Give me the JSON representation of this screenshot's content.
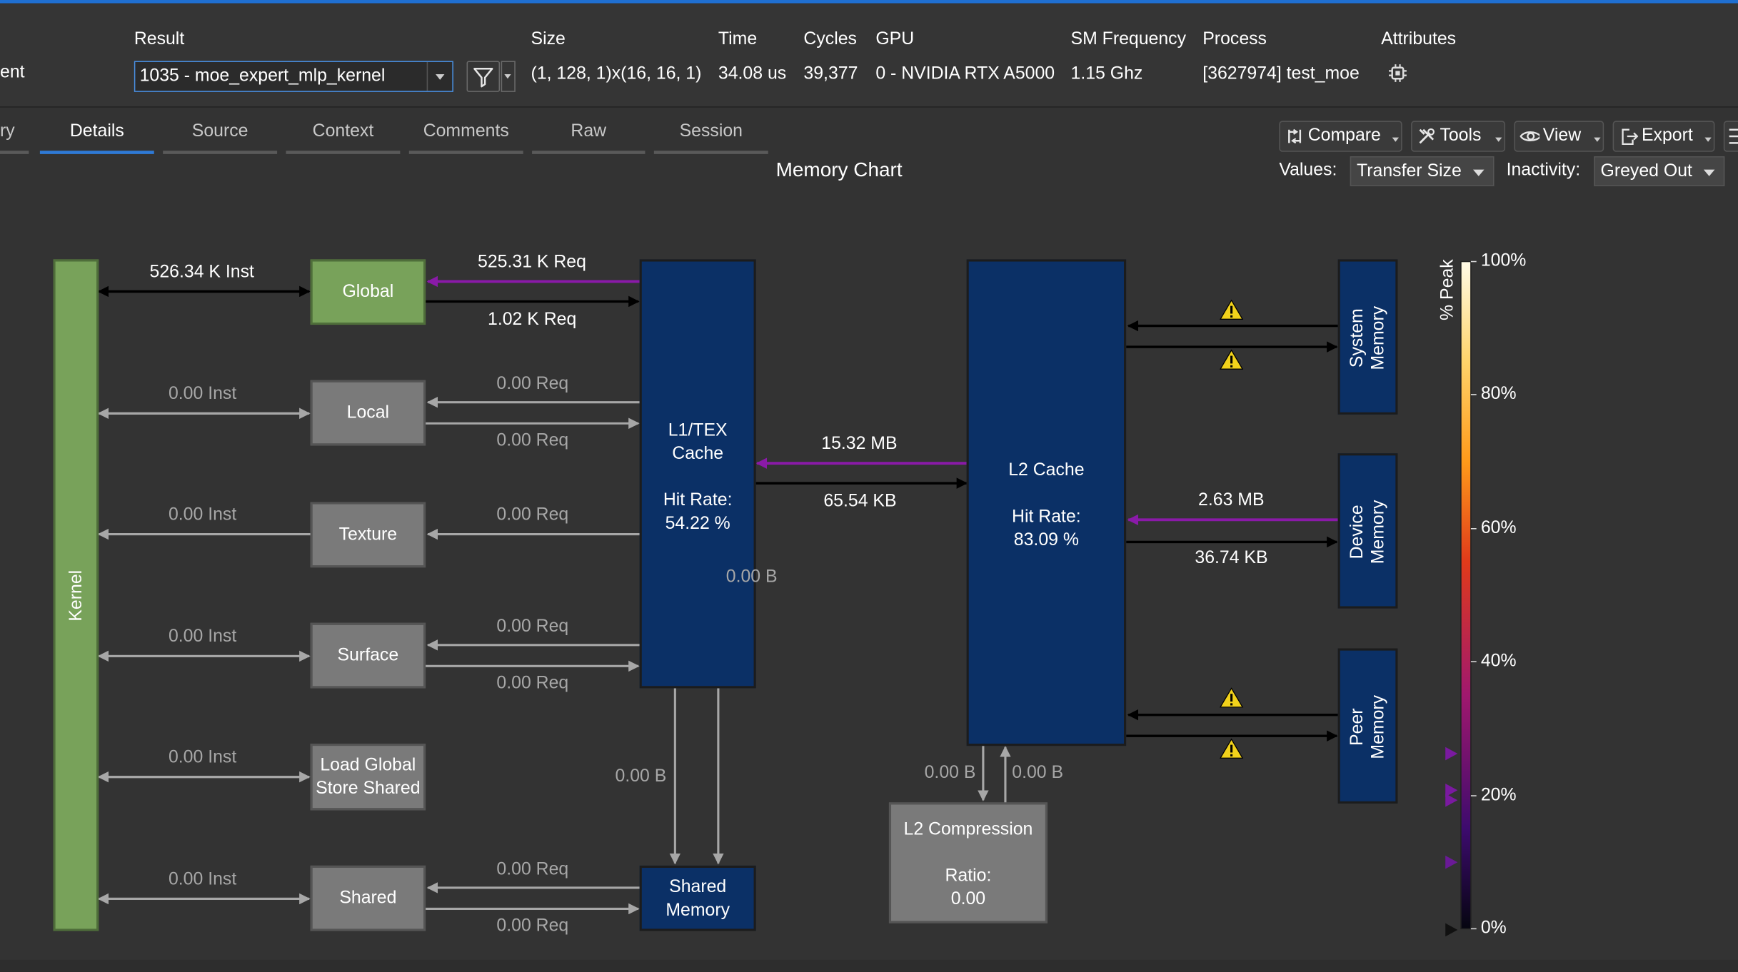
{
  "header": {
    "left_cut_label": "ent",
    "columns": {
      "result": "Result",
      "size": "Size",
      "time": "Time",
      "cycles": "Cycles",
      "gpu": "GPU",
      "sm_frequency": "SM Frequency",
      "process": "Process",
      "attributes": "Attributes"
    },
    "values": {
      "result": "1035 - moe_expert_mlp_kernel",
      "size": "(1, 128, 1)x(16, 16, 1)",
      "time": "34.08 us",
      "cycles": "39,377",
      "gpu": "0 - NVIDIA RTX A5000",
      "sm_frequency": "1.15 Ghz",
      "process": "[3627974] test_moe"
    },
    "attributes_icon": "chip-icon",
    "filter_icon": "filter-icon"
  },
  "tabs": {
    "partial": "ry",
    "items": [
      "Details",
      "Source",
      "Context",
      "Comments",
      "Raw",
      "Session"
    ],
    "active": "Details"
  },
  "toolbar": {
    "compare": "Compare",
    "tools": "Tools",
    "view": "View",
    "export": "Export"
  },
  "chart": {
    "title": "Memory Chart",
    "values_label": "Values:",
    "values_selected": "Transfer Size",
    "inactivity_label": "Inactivity:",
    "inactivity_selected": "Greyed Out"
  },
  "diagram": {
    "kernel": "Kernel",
    "global": "Global",
    "local": "Local",
    "texture": "Texture",
    "surface": "Surface",
    "load_global_line1": "Load Global",
    "load_global_line2": "Store Shared",
    "shared": "Shared",
    "l1_line1": "L1/TEX",
    "l1_line2": "Cache",
    "l1_hit_label": "Hit Rate:",
    "l1_hit_value": "54.22 %",
    "l2_line1": "L2 Cache",
    "l2_hit_label": "Hit Rate:",
    "l2_hit_value": "83.09 %",
    "shared_memory_line1": "Shared",
    "shared_memory_line2": "Memory",
    "l2_compression": "L2 Compression",
    "l2_ratio_label": "Ratio:",
    "l2_ratio_value": "0.00",
    "system_memory_line1": "System",
    "system_memory_line2": "Memory",
    "device_memory_line1": "Device",
    "device_memory_line2": "Memory",
    "peer_memory_line1": "Peer",
    "peer_memory_line2": "Memory",
    "links": {
      "kernel_global_inst": "526.34 K Inst",
      "global_req_in": "525.31 K Req",
      "global_req_out": "1.02 K Req",
      "local_inst": "0.00 Inst",
      "local_req_in": "0.00 Req",
      "local_req_out": "0.00 Req",
      "texture_inst": "0.00 Inst",
      "texture_req": "0.00 Req",
      "surface_inst": "0.00 Inst",
      "surface_req_in": "0.00 Req",
      "surface_req_out": "0.00 Req",
      "load_global_inst": "0.00 Inst",
      "shared_inst": "0.00 Inst",
      "shared_req_in": "0.00 Req",
      "shared_req_out": "0.00 Req",
      "l1_l2_in": "15.32 MB",
      "l1_l2_out": "65.54 KB",
      "l1_shared_dashed": "0.00 B",
      "l1_shared": "0.00 B",
      "l2_compression_out": "0.00 B",
      "l2_compression_in": "0.00 B",
      "device_in": "2.63 MB",
      "device_out": "36.74 KB"
    },
    "warning_icon": "warning-icon"
  },
  "legend": {
    "axis_title": "% Peak",
    "ticks": [
      "100%",
      "80%",
      "60%",
      "40%",
      "20%",
      "0%"
    ],
    "gradient_colors": [
      "#fffbe6",
      "#ff9a1a",
      "#e03a1a",
      "#a0186e",
      "#3d0b6e",
      "#050510"
    ]
  },
  "colors": {
    "accent": "#2f7ad6",
    "active_link": "#8a1aa8",
    "inactive_link": "#a7a7a7",
    "cache_blue": "#0b3066",
    "global_green": "#78a25a",
    "warning": "#f2d21b"
  }
}
